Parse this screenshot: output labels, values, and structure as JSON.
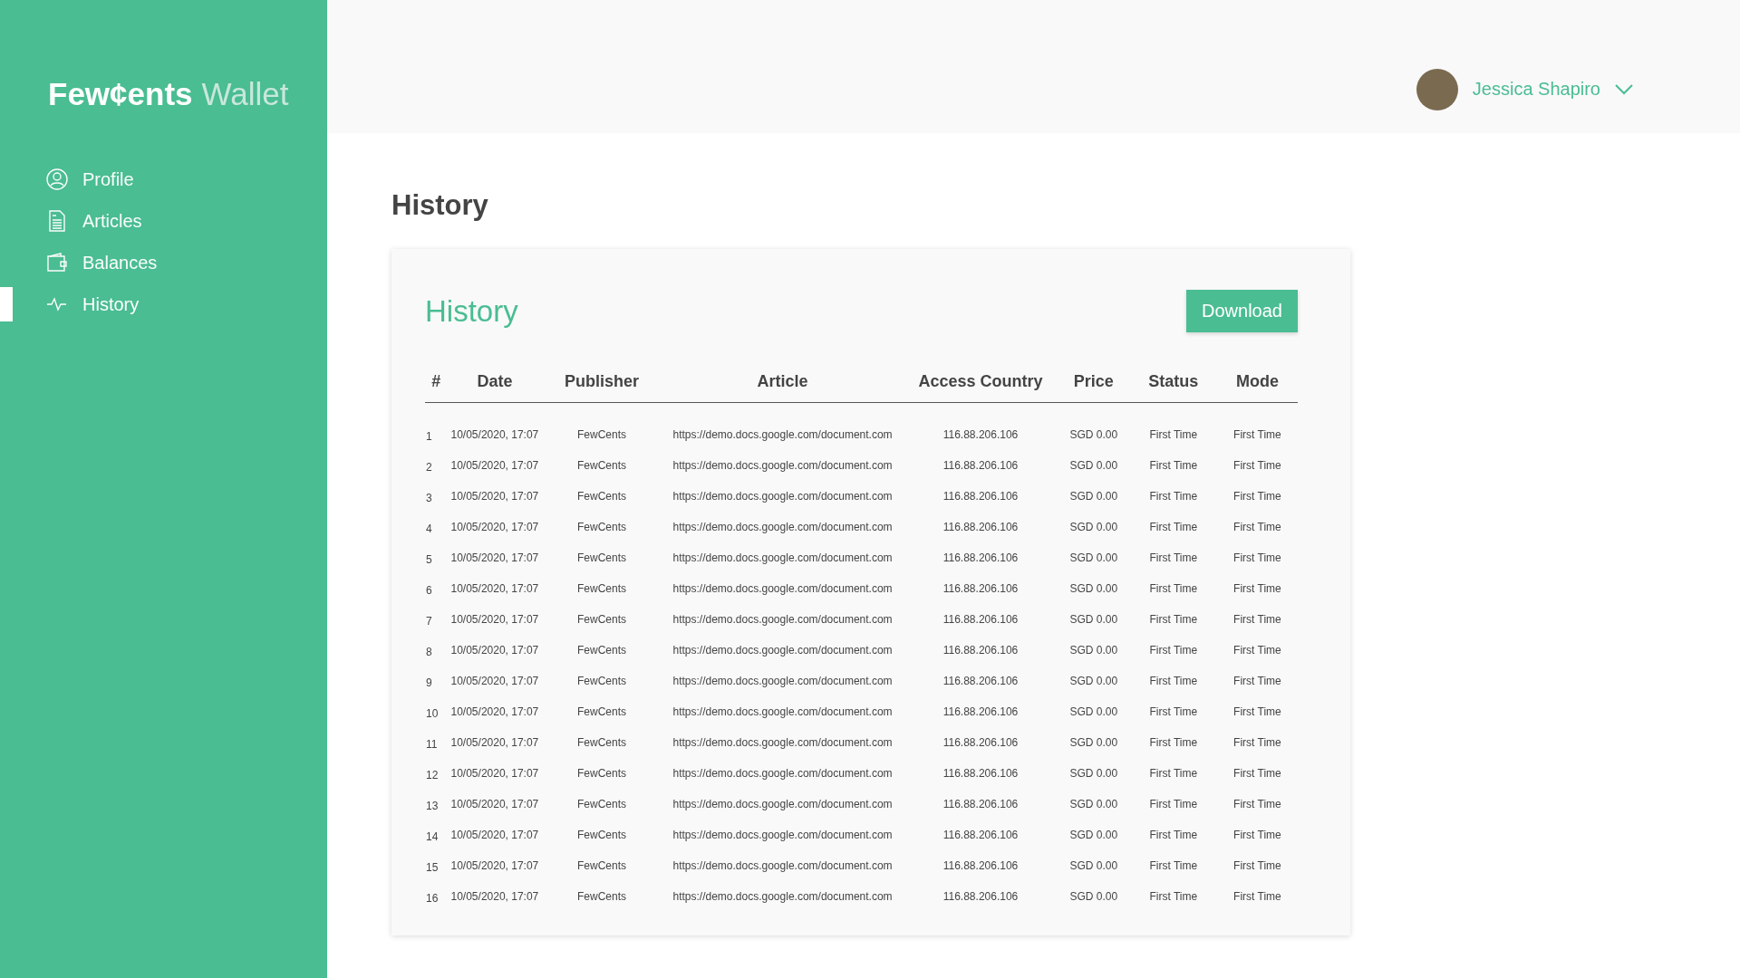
{
  "brand": {
    "name": "Few¢ents",
    "suffix": "Wallet"
  },
  "sidebar": {
    "items": [
      {
        "label": "Profile",
        "selected": false
      },
      {
        "label": "Articles",
        "selected": false
      },
      {
        "label": "Balances",
        "selected": false
      },
      {
        "label": "History",
        "selected": true
      }
    ]
  },
  "user": {
    "name": "Jessica Shapiro"
  },
  "page_title": "History",
  "card": {
    "title": "History",
    "download_button": "Download",
    "table": {
      "columns": [
        "#",
        "Date",
        "Publisher",
        "Article",
        "Access Country",
        "Price",
        "Status",
        "Mode"
      ],
      "rows": [
        [
          "1",
          "10/05/2020, 17:07",
          "FewCents",
          "https://demo.docs.google.com/document.com",
          "116.88.206.106",
          "SGD 0.00",
          "First Time",
          "First Time"
        ],
        [
          "2",
          "10/05/2020, 17:07",
          "FewCents",
          "https://demo.docs.google.com/document.com",
          "116.88.206.106",
          "SGD 0.00",
          "First Time",
          "First Time"
        ],
        [
          "3",
          "10/05/2020, 17:07",
          "FewCents",
          "https://demo.docs.google.com/document.com",
          "116.88.206.106",
          "SGD 0.00",
          "First Time",
          "First Time"
        ],
        [
          "4",
          "10/05/2020, 17:07",
          "FewCents",
          "https://demo.docs.google.com/document.com",
          "116.88.206.106",
          "SGD 0.00",
          "First Time",
          "First Time"
        ],
        [
          "5",
          "10/05/2020, 17:07",
          "FewCents",
          "https://demo.docs.google.com/document.com",
          "116.88.206.106",
          "SGD 0.00",
          "First Time",
          "First Time"
        ],
        [
          "6",
          "10/05/2020, 17:07",
          "FewCents",
          "https://demo.docs.google.com/document.com",
          "116.88.206.106",
          "SGD 0.00",
          "First Time",
          "First Time"
        ],
        [
          "7",
          "10/05/2020, 17:07",
          "FewCents",
          "https://demo.docs.google.com/document.com",
          "116.88.206.106",
          "SGD 0.00",
          "First Time",
          "First Time"
        ],
        [
          "8",
          "10/05/2020, 17:07",
          "FewCents",
          "https://demo.docs.google.com/document.com",
          "116.88.206.106",
          "SGD 0.00",
          "First Time",
          "First Time"
        ],
        [
          "9",
          "10/05/2020, 17:07",
          "FewCents",
          "https://demo.docs.google.com/document.com",
          "116.88.206.106",
          "SGD 0.00",
          "First Time",
          "First Time"
        ],
        [
          "10",
          "10/05/2020, 17:07",
          "FewCents",
          "https://demo.docs.google.com/document.com",
          "116.88.206.106",
          "SGD 0.00",
          "First Time",
          "First Time"
        ],
        [
          "11",
          "10/05/2020, 17:07",
          "FewCents",
          "https://demo.docs.google.com/document.com",
          "116.88.206.106",
          "SGD 0.00",
          "First Time",
          "First Time"
        ],
        [
          "12",
          "10/05/2020, 17:07",
          "FewCents",
          "https://demo.docs.google.com/document.com",
          "116.88.206.106",
          "SGD 0.00",
          "First Time",
          "First Time"
        ],
        [
          "13",
          "10/05/2020, 17:07",
          "FewCents",
          "https://demo.docs.google.com/document.com",
          "116.88.206.106",
          "SGD 0.00",
          "First Time",
          "First Time"
        ],
        [
          "14",
          "10/05/2020, 17:07",
          "FewCents",
          "https://demo.docs.google.com/document.com",
          "116.88.206.106",
          "SGD 0.00",
          "First Time",
          "First Time"
        ],
        [
          "15",
          "10/05/2020, 17:07",
          "FewCents",
          "https://demo.docs.google.com/document.com",
          "116.88.206.106",
          "SGD 0.00",
          "First Time",
          "First Time"
        ],
        [
          "16",
          "10/05/2020, 17:07",
          "FewCents",
          "https://demo.docs.google.com/document.com",
          "116.88.206.106",
          "SGD 0.00",
          "First Time",
          "First Time"
        ]
      ]
    }
  }
}
